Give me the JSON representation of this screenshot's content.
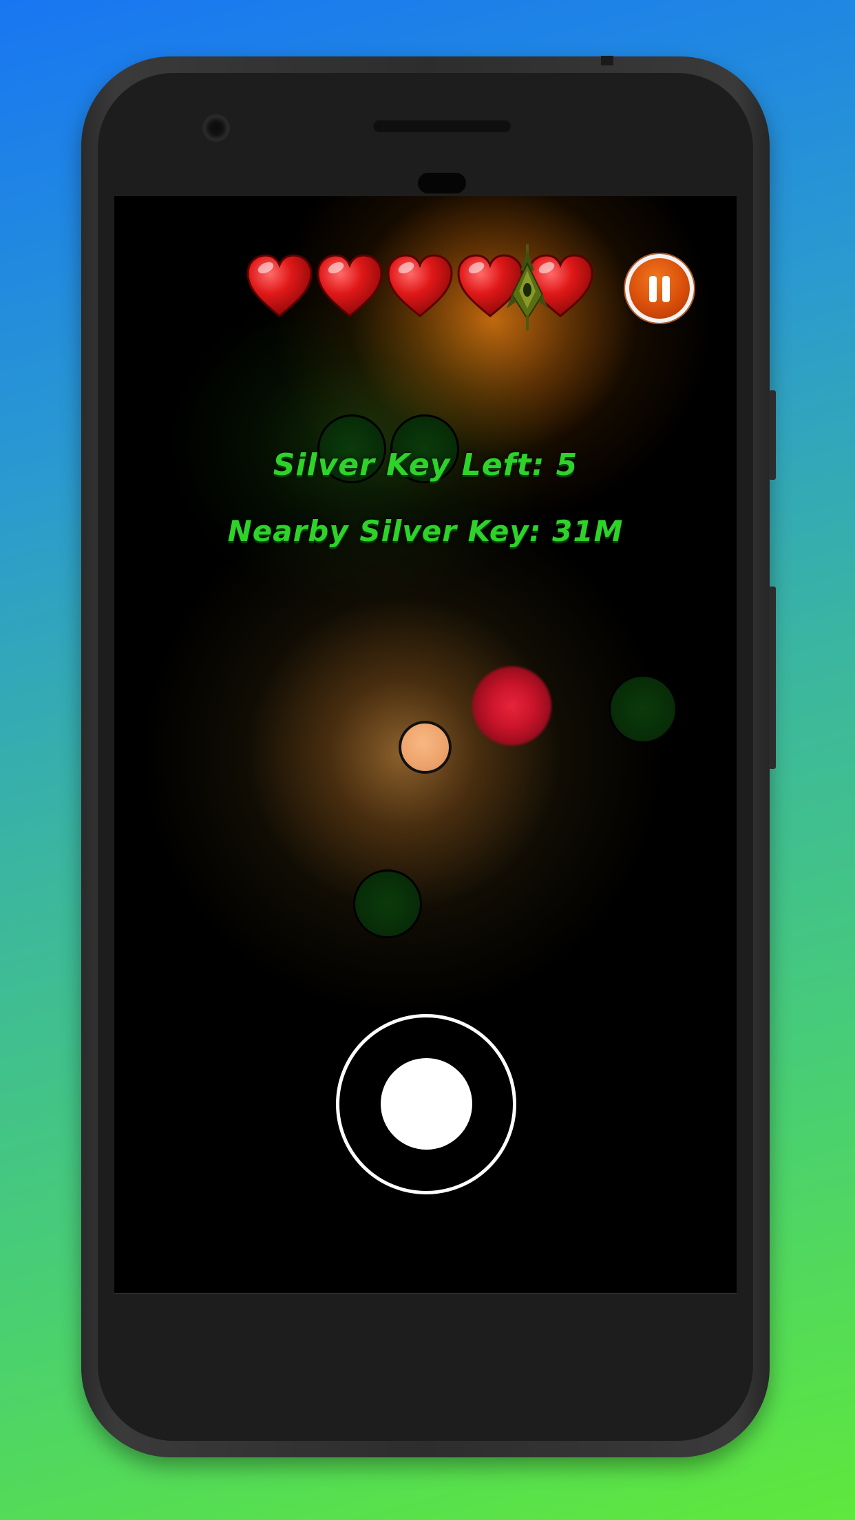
{
  "hud": {
    "lives": 5,
    "silver_keys_left_text": "Silver Key Left: 5",
    "nearby_silver_key_text": "Nearby Silver Key: 31M"
  },
  "icons": {
    "heart": "heart-icon",
    "pause": "pause-icon",
    "enemy": "enemy-ship-icon"
  },
  "colors": {
    "hud_text": "#2ed32a",
    "heart": "#e01818",
    "pause_button": "#d94e0a",
    "player": "#eda36c",
    "enemy_orb": "#0b3a0b"
  }
}
